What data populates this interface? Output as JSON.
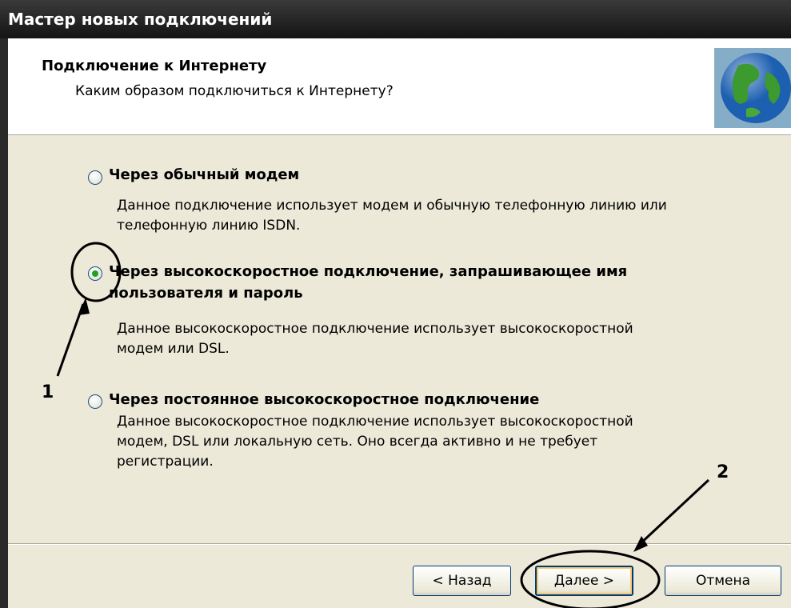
{
  "window": {
    "title": "Мастер новых подключений"
  },
  "header": {
    "title": "Подключение к Интернету",
    "subtitle": "Каким образом подключиться к Интернету?",
    "icon": "globe-icon"
  },
  "options": [
    {
      "label": "Через обычный модем",
      "description": [
        "Данное подключение использует модем и обычную телефонную линию или",
        "телефонную линию ISDN."
      ],
      "selected": false
    },
    {
      "label": [
        "Через высокоскоростное подключение, запрашивающее имя",
        "пользователя и пароль"
      ],
      "description": [
        "Данное высокоскоростное подключение использует высокоскоростной",
        "модем или DSL."
      ],
      "selected": true
    },
    {
      "label": "Через постоянное высокоскоростное подключение",
      "description": [
        "Данное высокоскоростное подключение использует высокоскоростной",
        "модем, DSL или локальную сеть. Оно всегда активно и не требует",
        "регистрации."
      ],
      "selected": false
    }
  ],
  "buttons": {
    "back": "< Назад",
    "next": "Далее >",
    "cancel": "Отмена"
  },
  "annotations": {
    "marker1": "1",
    "marker2": "2"
  },
  "colors": {
    "titlebar": "#1a1a1a",
    "dialog_bg": "#ece9d8",
    "radio_dot": "#21a121",
    "button_border": "#003c74"
  }
}
